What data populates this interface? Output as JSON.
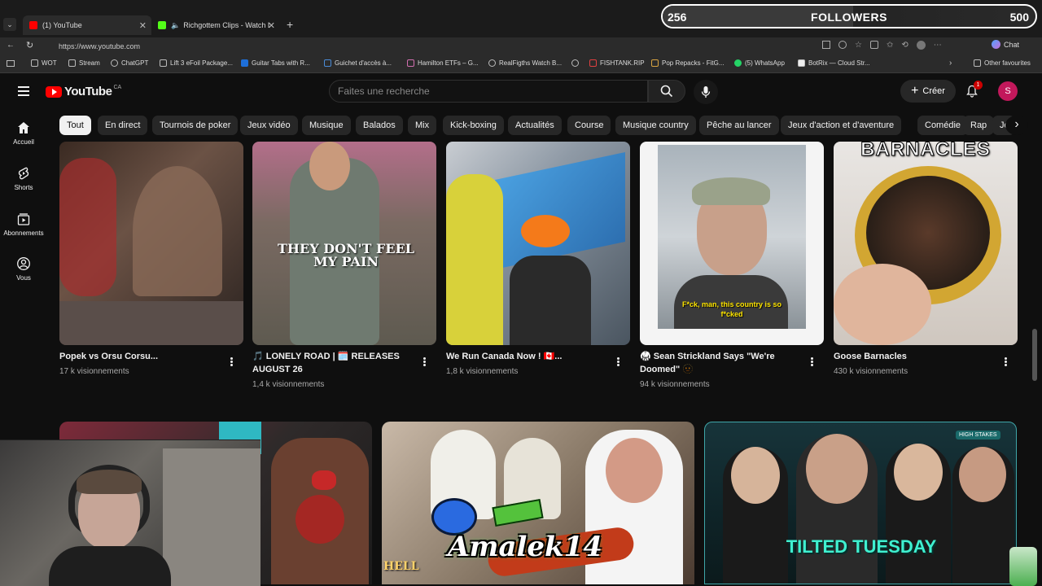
{
  "browser": {
    "tabs": [
      {
        "title": "(1) YouTube",
        "active": true
      },
      {
        "title": "Richgottem Clips - Watch Live",
        "active": false
      }
    ],
    "url": "https://www.youtube.com",
    "chat_label": "Chat",
    "bookmarks": [
      "WOT",
      "Stream",
      "ChatGPT",
      "Lift 3 eFoil Package...",
      "Guitar Tabs with R...",
      "Guichet d'accès à...",
      "Hamilton ETFs – G...",
      "RealFigths Watch B...",
      "FISHTANK.RIP",
      "Pop Repacks - FitG...",
      "(5) WhatsApp",
      "BotRix — Cloud Str...",
      "Other favourites"
    ]
  },
  "followers": {
    "current": "256",
    "label": "FOLLOWERS",
    "goal": "500",
    "progress": 0.512
  },
  "youtube": {
    "logo": "YouTube",
    "logo_region": "CA",
    "search_placeholder": "Faites une recherche",
    "create_label": "Créer",
    "notification_count": "1",
    "avatar_letter": "S",
    "chips": [
      "Tout",
      "En direct",
      "Tournois de poker",
      "Jeux vidéo",
      "Musique",
      "Balados",
      "Mix",
      "Kick-boxing",
      "Actualités",
      "Course",
      "Musique country",
      "Pêche au lancer",
      "Jeux d'action et d'aventure",
      "Comédie",
      "Rap",
      "Je"
    ],
    "sidebar": [
      {
        "label": "Accueil",
        "icon": "home-icon"
      },
      {
        "label": "Shorts",
        "icon": "shorts-icon"
      },
      {
        "label": "Abonnements",
        "icon": "subscriptions-icon"
      },
      {
        "label": "Vous",
        "icon": "you-icon"
      }
    ],
    "shorts": [
      {
        "title": "Popek vs Orsu Corsu...",
        "views": "17 k visionnements"
      },
      {
        "title": "🎵 LONELY ROAD | 🗓️ RELEASES AUGUST 26",
        "views": "1,4 k visionnements",
        "overlay": "THEY DON'T FEEL MY PAIN"
      },
      {
        "title": "We Run Canada Now ! 🇨🇦...",
        "views": "1,8 k visionnements"
      },
      {
        "title": "🥋 Sean Strickland Says \"We're Doomed\" 🫥",
        "views": "94 k visionnements",
        "overlay": "F*ck, man, this country is so f*cked"
      },
      {
        "title": "Goose Barnacles",
        "views": "430 k visionnements",
        "overlay": "BARNACLES"
      }
    ],
    "bottom_overlays": {
      "hell": "HELL",
      "tilted": "TILTED TUESDAY",
      "high_stakes": "HIGH STAKES"
    }
  },
  "stream_overlay": {
    "logo_text": "Amalek14"
  }
}
